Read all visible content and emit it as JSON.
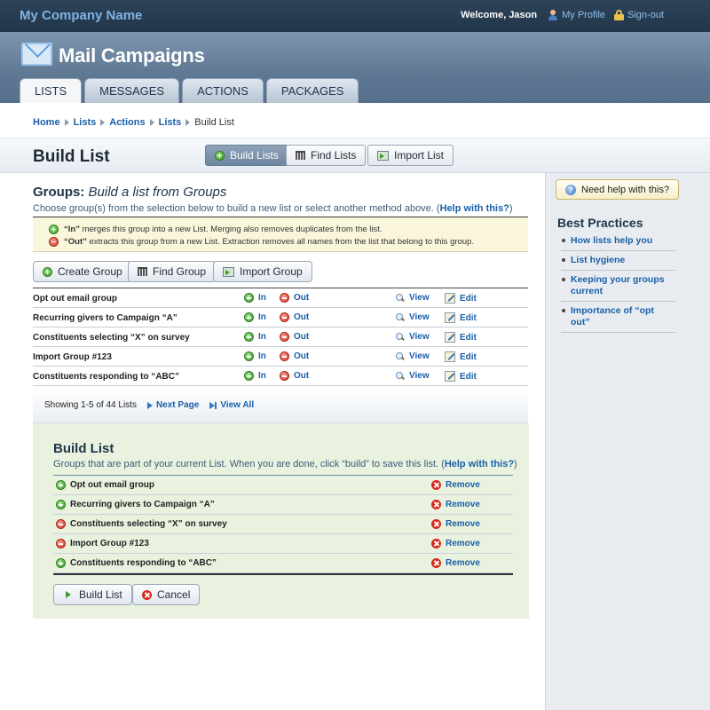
{
  "topbar": {
    "company": "My Company Name",
    "welcome": "Welcome, Jason",
    "profile_label": "My Profile",
    "signout_label": "Sign-out"
  },
  "header": {
    "app_title": "Mail Campaigns",
    "tabs": [
      {
        "label": "LISTS",
        "active": true
      },
      {
        "label": "MESSAGES",
        "active": false
      },
      {
        "label": "ACTIONS",
        "active": false
      },
      {
        "label": "PACKAGES",
        "active": false
      }
    ]
  },
  "breadcrumb": {
    "items": [
      "Home",
      "Lists",
      "Actions",
      "Lists"
    ],
    "current": "Build List"
  },
  "titlebar": {
    "title": "Build List",
    "buttons": [
      "Build Lists",
      "Find Lists",
      "Import List"
    ]
  },
  "groups": {
    "heading_bold": "Groups:",
    "heading_italic": "Build a list from Groups",
    "description": "Choose group(s) from the selection below to build a new list or select another method above. (",
    "help_link": "Help with this?",
    "description_end": ")",
    "legend_in_term": "“In”",
    "legend_in_text": "merges this group into a new List. Merging also removes duplicates from the list.",
    "legend_out_term": "“Out”",
    "legend_out_text": "extracts this group from a new List. Extraction removes all names from the list that belong to this group.",
    "buttons": [
      "Create Group",
      "Find Group",
      "Import Group"
    ],
    "action_labels": {
      "in": "In",
      "out": "Out",
      "view": "View",
      "edit": "Edit"
    },
    "rows": [
      "Opt out email group",
      "Recurring givers to Campaign “A”",
      "Constituents selecting “X” on survey",
      "Import Group #123",
      "Constituents responding to “ABC”"
    ],
    "pager": {
      "showing": "Showing 1-5 of 44 Lists",
      "next": "Next Page",
      "all": "View All"
    }
  },
  "build": {
    "title": "Build List",
    "description": "Groups that are part of your current List. When you are done, click “build” to save this list. (",
    "help_link": "Help with this?",
    "description_end": ")",
    "remove_label": "Remove",
    "rows": [
      {
        "name": "Opt out email group",
        "mode": "in"
      },
      {
        "name": "Recurring givers to Campaign “A”",
        "mode": "in"
      },
      {
        "name": "Constituents selecting “X” on survey",
        "mode": "out"
      },
      {
        "name": "Import Group #123",
        "mode": "out"
      },
      {
        "name": "Constituents responding to “ABC”",
        "mode": "in"
      }
    ],
    "buttons": {
      "build": "Build List",
      "cancel": "Cancel"
    }
  },
  "sidebar": {
    "help_button": "Need help with this?",
    "title": "Best Practices",
    "items": [
      "How lists help you",
      "List hygiene",
      "Keeping your groups current",
      "Importance of “opt out”"
    ]
  },
  "colors": {
    "link": "#1a5fa8",
    "topbar": "#2d4359",
    "header": "#5f7893",
    "build_bg": "#e9f2df",
    "legend_bg": "#faf6dc"
  }
}
